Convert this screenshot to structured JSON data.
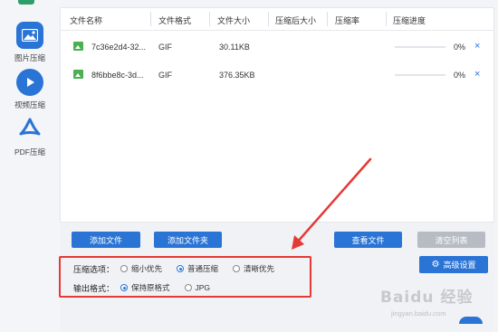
{
  "sidebar": {
    "items": [
      {
        "label": "图片压缩",
        "icon": "image-icon"
      },
      {
        "label": "视频压缩",
        "icon": "play-icon"
      },
      {
        "label": "PDF压缩",
        "icon": "pdf-icon"
      }
    ]
  },
  "table": {
    "columns": [
      "文件名称",
      "文件格式",
      "文件大小",
      "压缩后大小",
      "压缩率",
      "压缩进度"
    ],
    "rows": [
      {
        "name": "7c36e2d4-32...",
        "format": "GIF",
        "size": "30.11KB",
        "compressed_size": "",
        "ratio": "",
        "progress": "0%",
        "progress_value": 0
      },
      {
        "name": "8f6bbe8c-3d...",
        "format": "GIF",
        "size": "376.35KB",
        "compressed_size": "",
        "ratio": "",
        "progress": "0%",
        "progress_value": 0
      }
    ],
    "remove_glyph": "×"
  },
  "actions": {
    "add_file": "添加文件",
    "add_folder": "添加文件夹",
    "view_files": "查看文件",
    "clear_list": "清空列表",
    "advanced_settings": "高级设置"
  },
  "options": {
    "compression_label": "压缩选项：",
    "compression_choices": [
      {
        "label": "缩小优先",
        "selected": false
      },
      {
        "label": "普通压缩",
        "selected": true
      },
      {
        "label": "清晰优先",
        "selected": false
      }
    ],
    "format_label": "输出格式：",
    "format_choices": [
      {
        "label": "保持原格式",
        "selected": true
      },
      {
        "label": "JPG",
        "selected": false
      }
    ]
  },
  "watermark": {
    "brand": "Baidu 经验",
    "url": "jingyan.baidu.com"
  },
  "colors": {
    "accent": "#2a74d6",
    "annotation": "#e53935",
    "image_icon": "#4caf50"
  }
}
